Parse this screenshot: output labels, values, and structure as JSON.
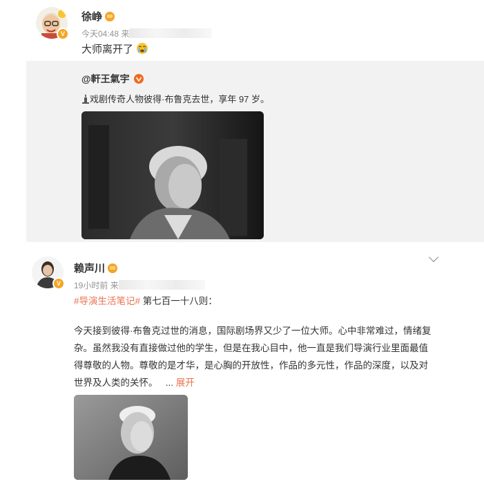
{
  "post1": {
    "author": "徐峥",
    "time": "今天04:48",
    "source_prefix": "来",
    "text": "大师离开了",
    "emoji": "cry-emoji"
  },
  "repost": {
    "author": "@軒王氣宇",
    "text": "戏剧传奇人物彼得·布鲁克去世，享年 97 岁。",
    "image_alt": "portrait-photo-peter-brook"
  },
  "post2": {
    "author": "赖声川",
    "time": "19小时前",
    "source_prefix": "来",
    "hashtag": "#导演生活笔记#",
    "heading": "第七百一十八则：",
    "body_lines": [
      "今天接到彼得·布鲁克过世的消息，国际剧场界又少了一位大师。心中非常难过，情绪复",
      "杂。虽然我没有直接做过他的学生，但是在我心目中，他一直是我们导演行业里面最值",
      "得尊敬的人物。尊敬的是才华，是心胸的开放性，作品的多元性，作品的深度，以及对",
      "世界及人类的关怀。"
    ],
    "ellipsis": "...",
    "expand": "展开",
    "image_alt": "portrait-photo-peter-brook-2"
  },
  "colors": {
    "link": "#eb7350",
    "repost_bg": "#f2f2f2",
    "verified": "#f5a623"
  }
}
